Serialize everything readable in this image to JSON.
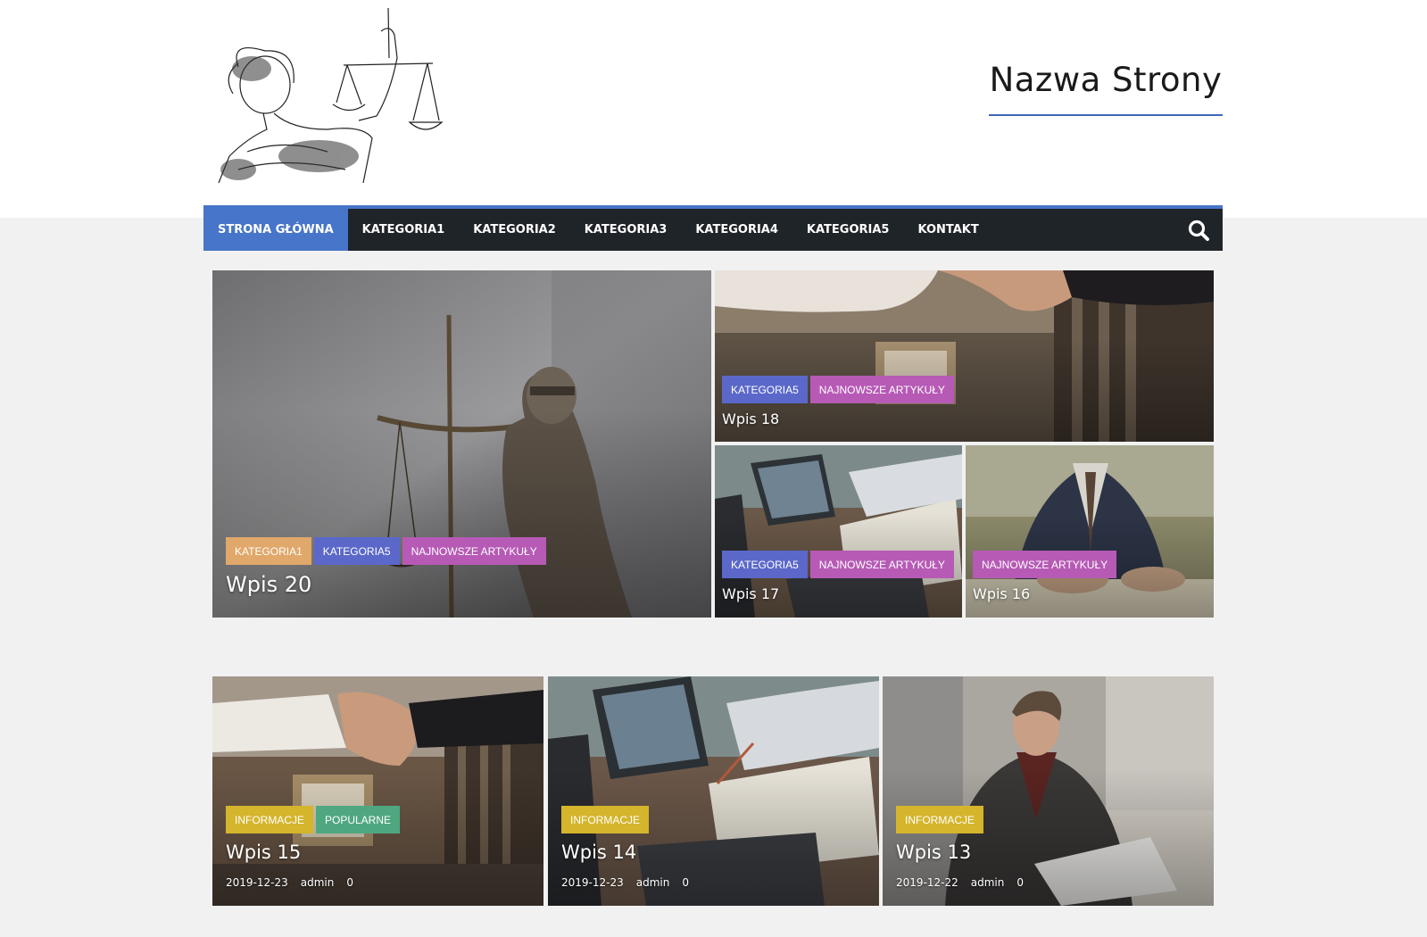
{
  "site": {
    "title": "Nazwa Strony"
  },
  "nav": {
    "items": [
      {
        "label": "STRONA GŁÓWNA",
        "active": true
      },
      {
        "label": "KATEGORIA1"
      },
      {
        "label": "KATEGORIA2"
      },
      {
        "label": "KATEGORIA3"
      },
      {
        "label": "KATEGORIA4"
      },
      {
        "label": "KATEGORIA5"
      },
      {
        "label": "KONTAKT"
      }
    ],
    "search_icon": "search-icon"
  },
  "colors": {
    "accent": "#4775c9",
    "nav_bg": "#1f2429",
    "kategoria1": "#e0a86a",
    "kategoria5": "#5b68c9",
    "najnowsze": "#b65ab5",
    "informacje": "#d4b52c",
    "popularne": "#4fa780"
  },
  "featured": [
    {
      "title": "Wpis 20",
      "tags": [
        "KATEGORIA1",
        "KATEGORIA5",
        "NAJNOWSZE ARTYKUŁY"
      ]
    },
    {
      "title": "Wpis 18",
      "tags": [
        "KATEGORIA5",
        "NAJNOWSZE ARTYKUŁY"
      ]
    },
    {
      "title": "Wpis 17",
      "tags": [
        "KATEGORIA5",
        "NAJNOWSZE ARTYKUŁY"
      ]
    },
    {
      "title": "Wpis 16",
      "tags": [
        "NAJNOWSZE ARTYKUŁY"
      ]
    }
  ],
  "posts": [
    {
      "title": "Wpis 15",
      "tags": [
        "INFORMACJE",
        "POPULARNE"
      ],
      "date": "2019-12-23",
      "author": "admin",
      "comments": "0"
    },
    {
      "title": "Wpis 14",
      "tags": [
        "INFORMACJE"
      ],
      "date": "2019-12-23",
      "author": "admin",
      "comments": "0"
    },
    {
      "title": "Wpis 13",
      "tags": [
        "INFORMACJE"
      ],
      "date": "2019-12-22",
      "author": "admin",
      "comments": "0"
    }
  ]
}
